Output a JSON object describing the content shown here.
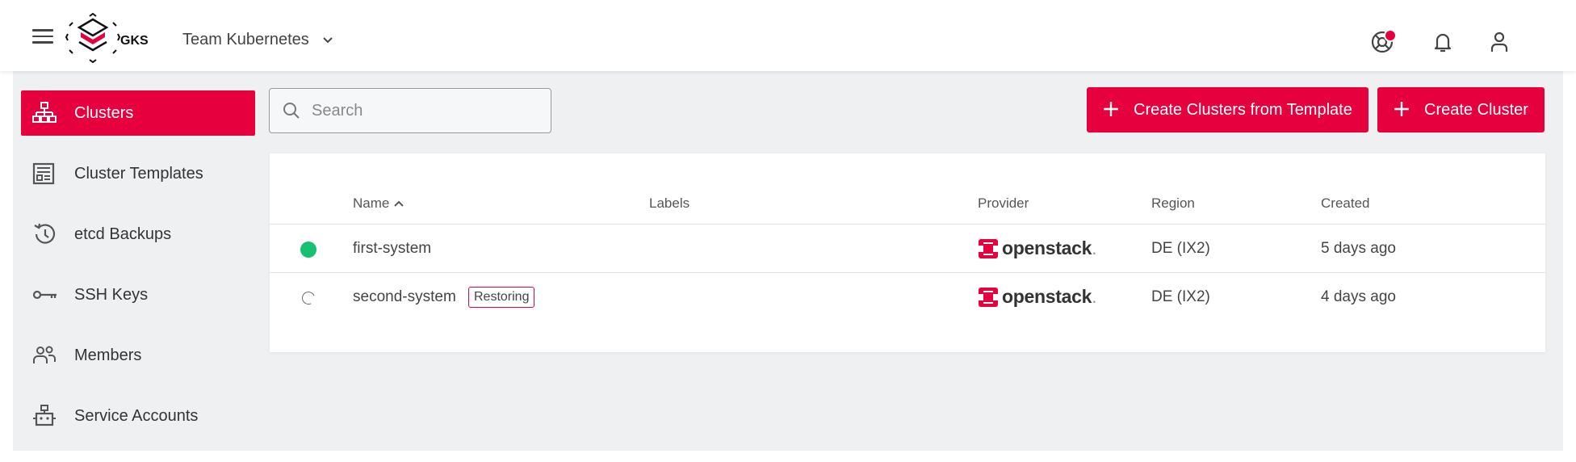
{
  "app": {
    "logo_text": "GKS",
    "brand_color": "#e6003d"
  },
  "header": {
    "project_name": "Team Kubernetes"
  },
  "sidebar": {
    "items": [
      {
        "label": "Clusters",
        "icon": "sitemap-icon",
        "active": true
      },
      {
        "label": "Cluster Templates",
        "icon": "template-icon"
      },
      {
        "label": "etcd Backups",
        "icon": "history-icon"
      },
      {
        "label": "SSH Keys",
        "icon": "key-icon"
      },
      {
        "label": "Members",
        "icon": "members-icon"
      },
      {
        "label": "Service Accounts",
        "icon": "robot-icon"
      }
    ]
  },
  "toolbar": {
    "search_placeholder": "Search",
    "create_from_template_label": "Create Clusters from Template",
    "create_cluster_label": "Create Cluster"
  },
  "table": {
    "columns": [
      "Name",
      "Labels",
      "Provider",
      "Region",
      "Created"
    ],
    "rows": [
      {
        "status": "running",
        "name": "first-system",
        "badge": "",
        "provider": "openstack",
        "region": "DE (IX2)",
        "created": "5 days ago"
      },
      {
        "status": "restoring",
        "name": "second-system",
        "badge": "Restoring",
        "provider": "openstack",
        "region": "DE (IX2)",
        "created": "4 days ago"
      }
    ]
  }
}
